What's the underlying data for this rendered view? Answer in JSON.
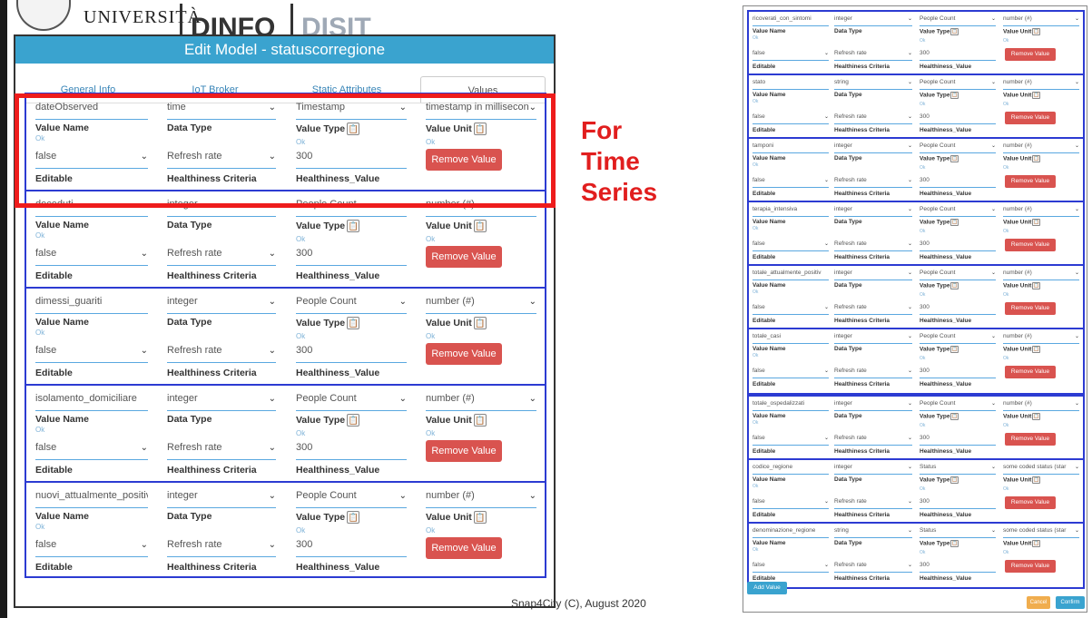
{
  "logo": {
    "univ": "UNIVERSITÀ",
    "dinfo": "DINFO",
    "disit": "DISIT"
  },
  "modal": {
    "title": "Edit Model - statuscorregione",
    "tabs": [
      "General Info",
      "IoT Broker",
      "Static Attributes",
      "Values"
    ]
  },
  "labels": {
    "value_name": "Value Name",
    "data_type": "Data Type",
    "value_type": "Value Type",
    "value_unit": "Value Unit",
    "editable": "Editable",
    "healthiness_criteria": "Healthiness Criteria",
    "healthiness_value": "Healthiness_Value",
    "ok": "Ok",
    "remove": "Remove Value",
    "clipboard": "📋"
  },
  "rows": [
    {
      "name": "dateObserved",
      "dtype": "time",
      "vtype": "Timestamp",
      "unit": "timestamp in millisecon",
      "editable": "false",
      "criteria": "Refresh rate",
      "hval": "300"
    },
    {
      "name": "deceduti",
      "dtype": "integer",
      "vtype": "People Count",
      "unit": "number (#)",
      "editable": "false",
      "criteria": "Refresh rate",
      "hval": "300"
    },
    {
      "name": "dimessi_guariti",
      "dtype": "integer",
      "vtype": "People Count",
      "unit": "number (#)",
      "editable": "false",
      "criteria": "Refresh rate",
      "hval": "300"
    },
    {
      "name": "isolamento_domiciliare",
      "dtype": "integer",
      "vtype": "People Count",
      "unit": "number (#)",
      "editable": "false",
      "criteria": "Refresh rate",
      "hval": "300"
    },
    {
      "name": "nuovi_attualmente_positiv",
      "dtype": "integer",
      "vtype": "People Count",
      "unit": "number (#)",
      "editable": "false",
      "criteria": "Refresh rate",
      "hval": "300"
    }
  ],
  "annotation": {
    "line1": "For",
    "line2": "Time",
    "line3": "Series"
  },
  "footer": "Snap4City (C), August 2020",
  "right_panel": {
    "group1": [
      {
        "name": "ricoverati_con_sintomi",
        "dtype": "integer",
        "vtype": "People Count",
        "unit": "number (#)"
      },
      {
        "name": "stato",
        "dtype": "string",
        "vtype": "People Count",
        "unit": "number (#)"
      },
      {
        "name": "tamponi",
        "dtype": "integer",
        "vtype": "People Count",
        "unit": "number (#)"
      },
      {
        "name": "terapia_intensiva",
        "dtype": "integer",
        "vtype": "People Count",
        "unit": "number (#)"
      },
      {
        "name": "totale_attualmente_positiv",
        "dtype": "integer",
        "vtype": "People Count",
        "unit": "number (#)"
      },
      {
        "name": "totale_casi",
        "dtype": "integer",
        "vtype": "People Count",
        "unit": "number (#)"
      }
    ],
    "group2": [
      {
        "name": "totale_ospedalizzati",
        "dtype": "integer",
        "vtype": "People Count",
        "unit": "number (#)"
      },
      {
        "name": "codice_regione",
        "dtype": "integer",
        "vtype": "Status",
        "unit": "some coded status (star"
      },
      {
        "name": "denominazione_regione",
        "dtype": "string",
        "vtype": "Status",
        "unit": "some coded status (star"
      }
    ],
    "editable": "false",
    "criteria": "Refresh rate",
    "hval": "300",
    "add_value": "Add Value",
    "cancel": "Cancel",
    "confirm": "Confirm"
  }
}
